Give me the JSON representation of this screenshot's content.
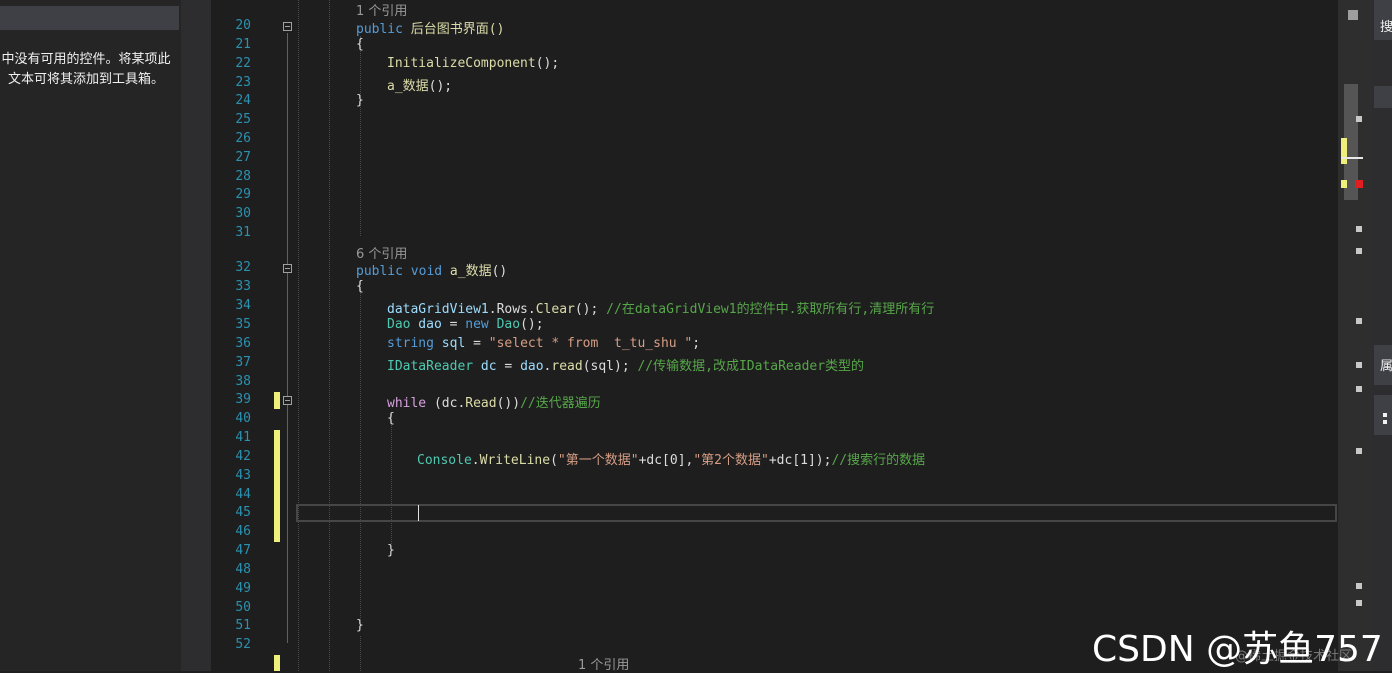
{
  "toolbox": {
    "message": "中没有可用的控件。将某项此文本可将其添加到工具箱。"
  },
  "lens": {
    "line19": "1 个引用",
    "line31": "6 个引用",
    "line53": "1 个引用"
  },
  "lines": {
    "n20": "20",
    "n21": "21",
    "n22": "22",
    "n23": "23",
    "n24": "24",
    "n25": "25",
    "n26": "26",
    "n27": "27",
    "n28": "28",
    "n29": "29",
    "n30": "30",
    "n31": "31",
    "n32": "32",
    "n33": "33",
    "n34": "34",
    "n35": "35",
    "n36": "36",
    "n37": "37",
    "n38": "38",
    "n39": "39",
    "n40": "40",
    "n41": "41",
    "n42": "42",
    "n43": "43",
    "n44": "44",
    "n45": "45",
    "n46": "46",
    "n47": "47",
    "n48": "48",
    "n49": "49",
    "n50": "50",
    "n51": "51",
    "n52": "52"
  },
  "code": {
    "l20_kw": "public",
    "l20_name": " 后台图书界面()",
    "l21": "{",
    "l22_m": "InitializeComponent",
    "l22_t": "();",
    "l23_m": "a_数据",
    "l23_t": "();",
    "l24": "}",
    "l32_kw1": "public",
    "l32_kw2": " void",
    "l32_m": " a_数据",
    "l32_t": "()",
    "l33": "{",
    "l34_a": "dataGridView1",
    "l34_b": ".Rows.",
    "l34_c": "Clear",
    "l34_d": "(); ",
    "l34_cm": "//在dataGridView1的控件中.获取所有行,清理所有行",
    "l35_a": "Dao",
    "l35_b": " dao",
    "l35_c": " = ",
    "l35_d": "new",
    "l35_e": " Dao",
    "l35_f": "();",
    "l36_a": "string",
    "l36_b": " sql",
    "l36_c": " = ",
    "l36_d": "\"select * from  t_tu_shu \"",
    "l36_e": ";",
    "l37_a": "IDataReader",
    "l37_b": " dc",
    "l37_c": " = ",
    "l37_d": "dao",
    "l37_e": ".",
    "l37_f": "read",
    "l37_g": "(sql); ",
    "l37_cm": "//传输数据,改成IDataReader类型的",
    "l39_a": "while",
    "l39_b": " (dc.",
    "l39_c": "Read",
    "l39_d": "())",
    "l39_cm": "//迭代器遍历",
    "l40": "{",
    "l42_a": "Console",
    "l42_b": ".",
    "l42_c": "WriteLine",
    "l42_d": "(",
    "l42_e": "\"第一个数据\"",
    "l42_f": "+dc[0],",
    "l42_g": "\"第2个数据\"",
    "l42_h": "+dc[1]);",
    "l42_cm": "//搜索行的数据",
    "l47": "}",
    "l51": "}"
  },
  "right_panel": {
    "tab1": "搜",
    "tab2": "属"
  },
  "watermark": {
    "main": "CSDN @苏鱼757",
    "sub": "@稀土掘金技术社区"
  }
}
